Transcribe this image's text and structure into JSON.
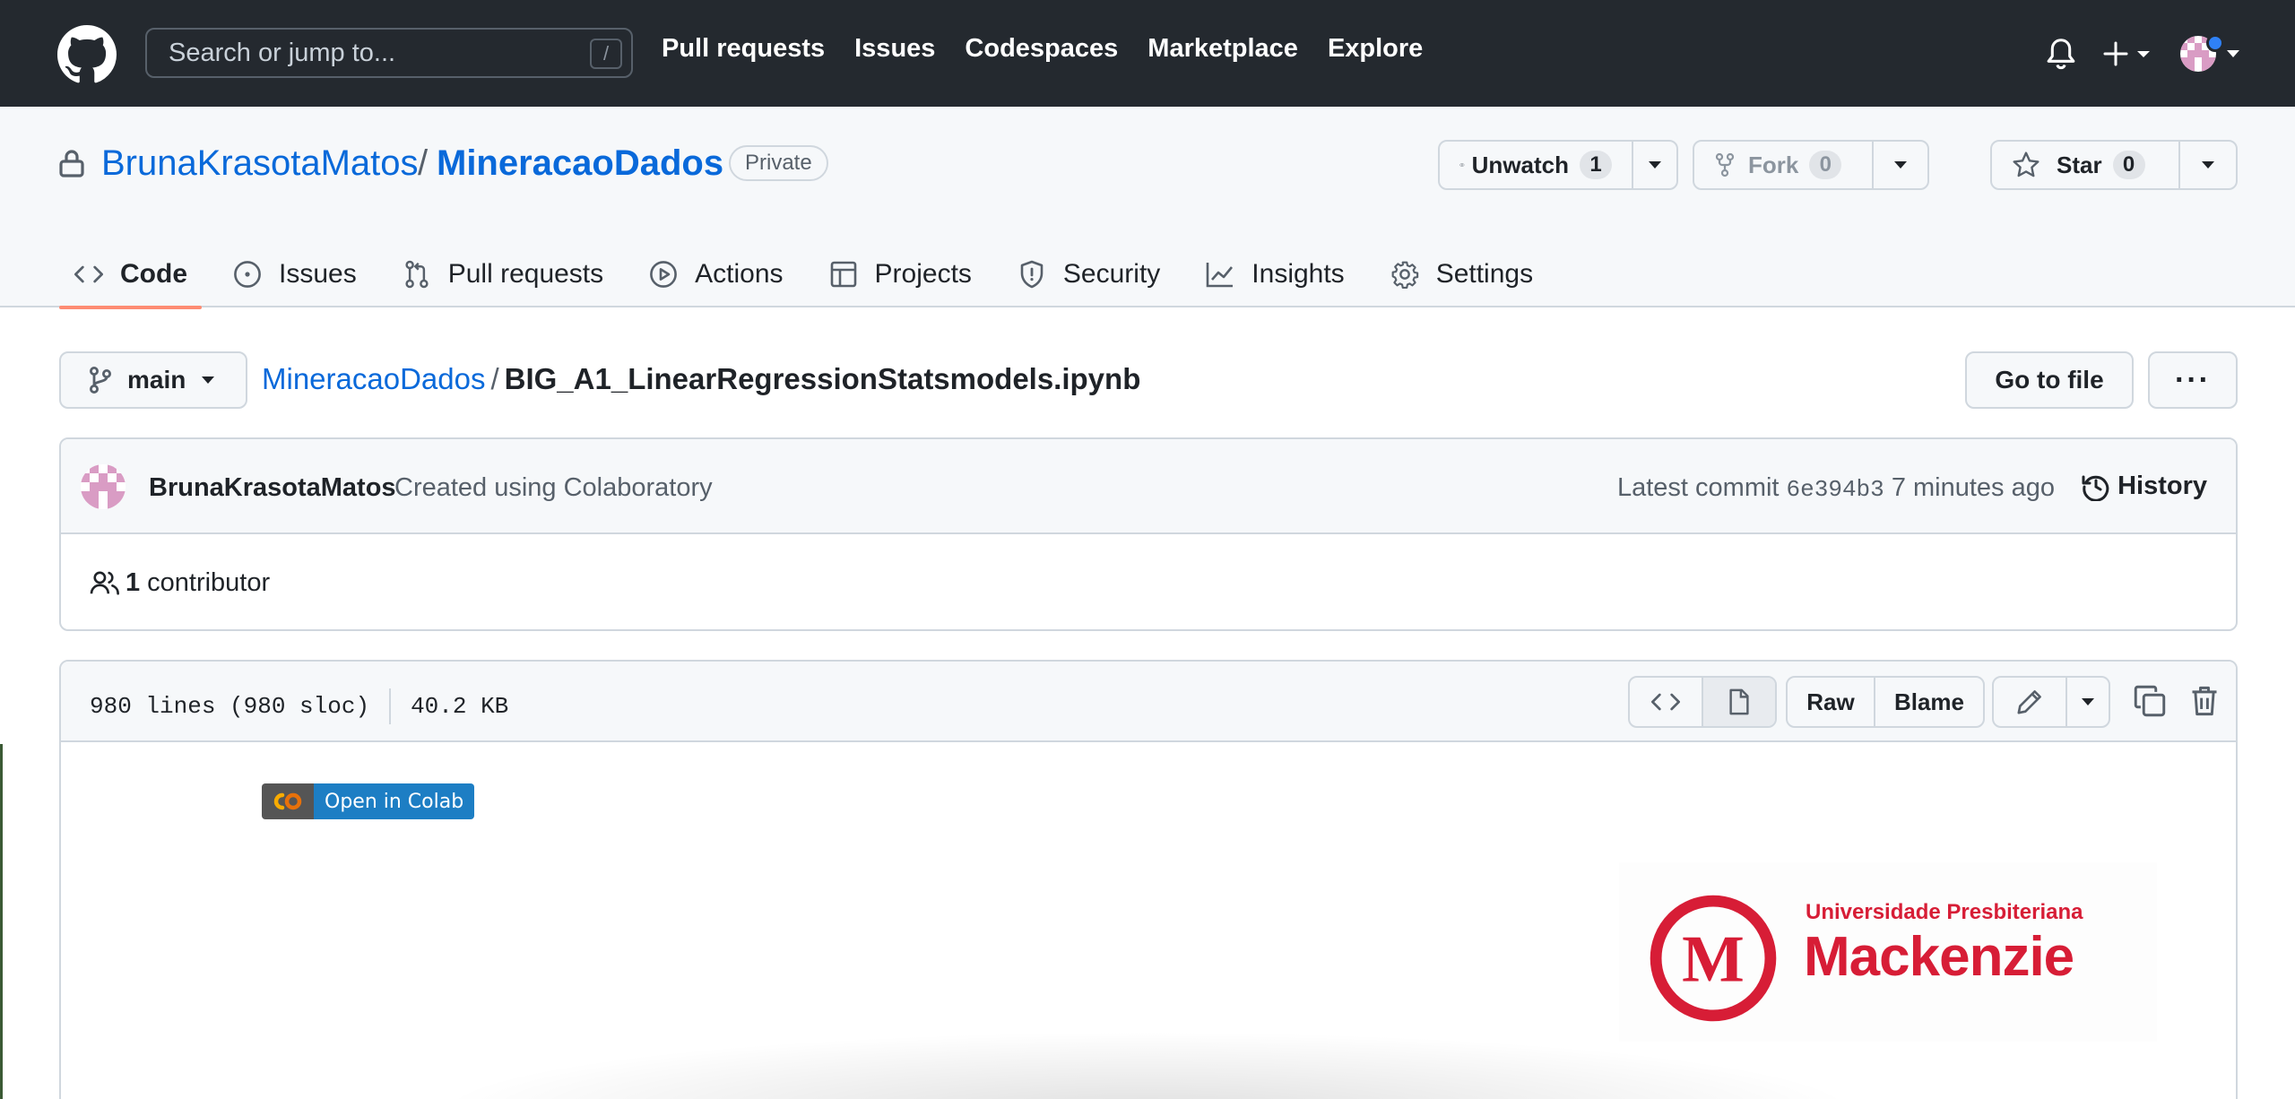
{
  "header": {
    "search_placeholder": "Search or jump to...",
    "search_shortcut": "/",
    "nav": [
      "Pull requests",
      "Issues",
      "Codespaces",
      "Marketplace",
      "Explore"
    ]
  },
  "repo": {
    "owner": "BrunaKrasotaMatos",
    "separator": "/",
    "name": "MineracaoDados",
    "visibility": "Private",
    "watch": {
      "label": "Unwatch",
      "count": "1"
    },
    "fork": {
      "label": "Fork",
      "count": "0"
    },
    "star": {
      "label": "Star",
      "count": "0"
    }
  },
  "tabs": [
    {
      "label": "Code",
      "icon": "code-icon"
    },
    {
      "label": "Issues",
      "icon": "issue-icon"
    },
    {
      "label": "Pull requests",
      "icon": "pull-request-icon"
    },
    {
      "label": "Actions",
      "icon": "play-icon"
    },
    {
      "label": "Projects",
      "icon": "table-icon"
    },
    {
      "label": "Security",
      "icon": "shield-icon"
    },
    {
      "label": "Insights",
      "icon": "graph-icon"
    },
    {
      "label": "Settings",
      "icon": "gear-icon"
    }
  ],
  "file": {
    "branch": "main",
    "repo_link": "MineracaoDados",
    "path_sep": "/",
    "filename": "BIG_A1_LinearRegressionStatsmodels.ipynb",
    "go_to_file": "Go to file",
    "more": "···"
  },
  "commit": {
    "author": "BrunaKrasotaMatos",
    "message": "Created using Colaboratory",
    "latest_label": "Latest commit",
    "sha": "6e394b3",
    "time": "7 minutes ago",
    "history": "History"
  },
  "contributors": {
    "count": "1",
    "label": "contributor"
  },
  "filemeta": {
    "lines": "980 lines (980 sloc)",
    "size": "40.2 KB",
    "raw": "Raw",
    "blame": "Blame"
  },
  "notebook": {
    "colab_badge": "Open in Colab",
    "logo_line1": "Universidade Presbiteriana",
    "logo_line2": "Mackenzie"
  },
  "colors": {
    "header_bg": "#24292f",
    "link": "#0969da",
    "tab_underline": "#fd8c73",
    "mackenzie_red": "#d71d36",
    "colab_blue": "#1d7ec4"
  }
}
